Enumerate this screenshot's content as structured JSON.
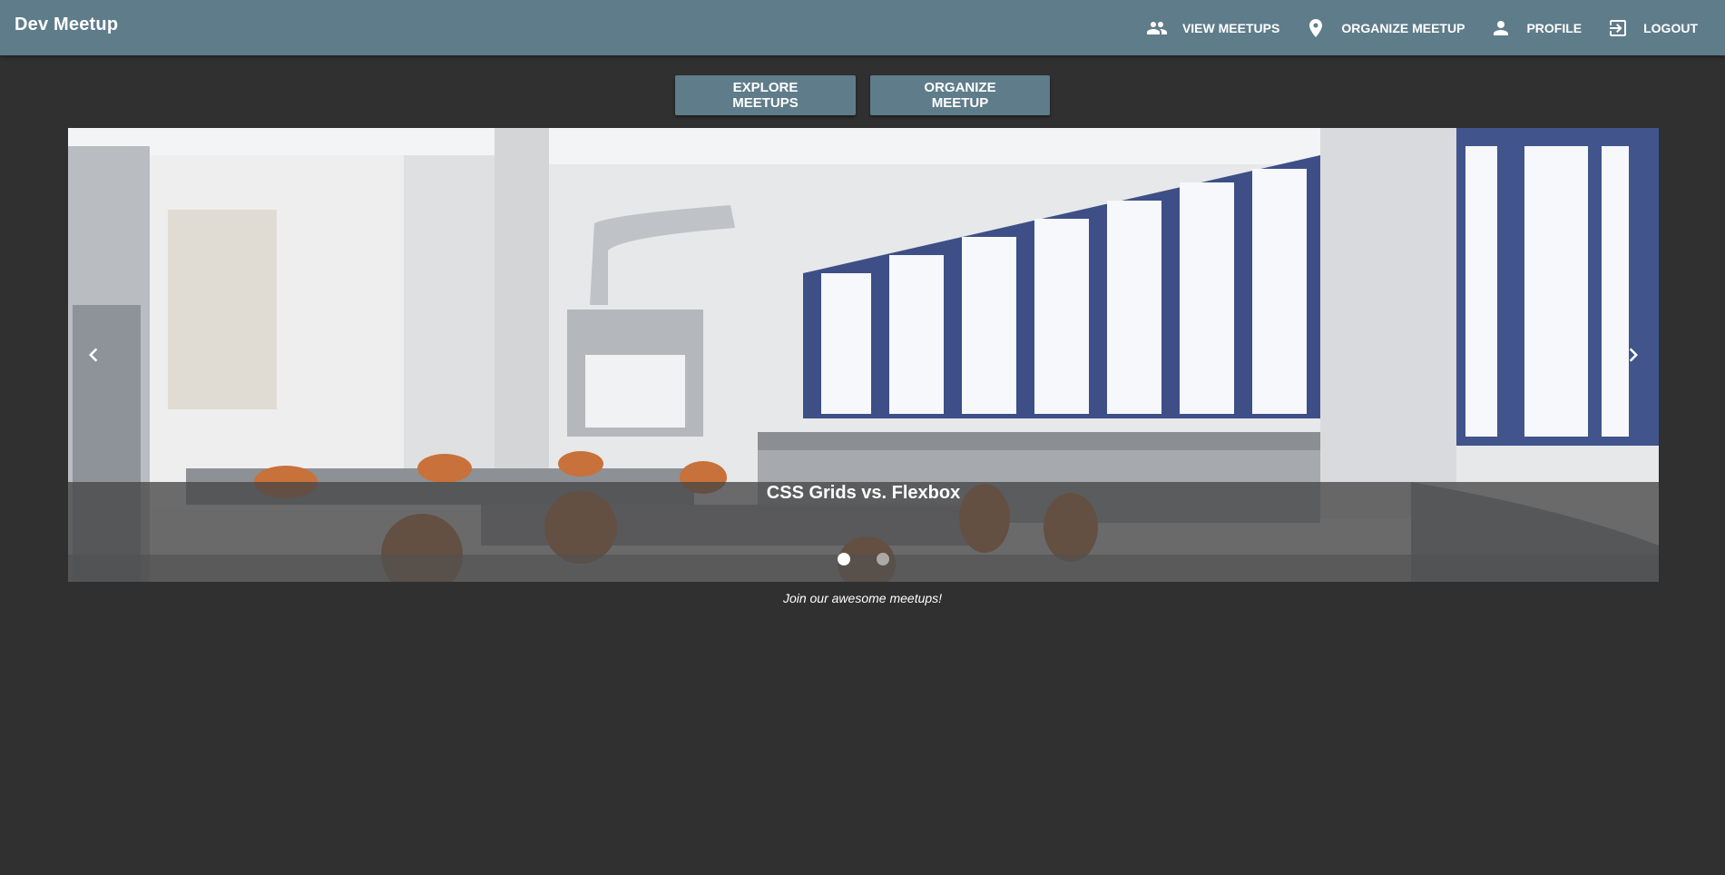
{
  "app": {
    "title": "Dev Meetup"
  },
  "nav": {
    "items": [
      {
        "label": "View Meetups",
        "icon": "people-icon"
      },
      {
        "label": "Organize Meetup",
        "icon": "location-pin-icon"
      },
      {
        "label": "Profile",
        "icon": "person-icon"
      },
      {
        "label": "Logout",
        "icon": "exit-icon"
      }
    ]
  },
  "actions": {
    "explore_label": "Explore Meetups",
    "organize_label": "Organize Meetup"
  },
  "carousel": {
    "slides": [
      {
        "title": "CSS Grids vs. Flexbox",
        "image": "lab-classroom-photo"
      }
    ],
    "slide_count": 2,
    "active_index": 0
  },
  "tagline": "Join our awesome meetups!",
  "colors": {
    "primary": "#5f7c8a",
    "background": "#303030"
  }
}
